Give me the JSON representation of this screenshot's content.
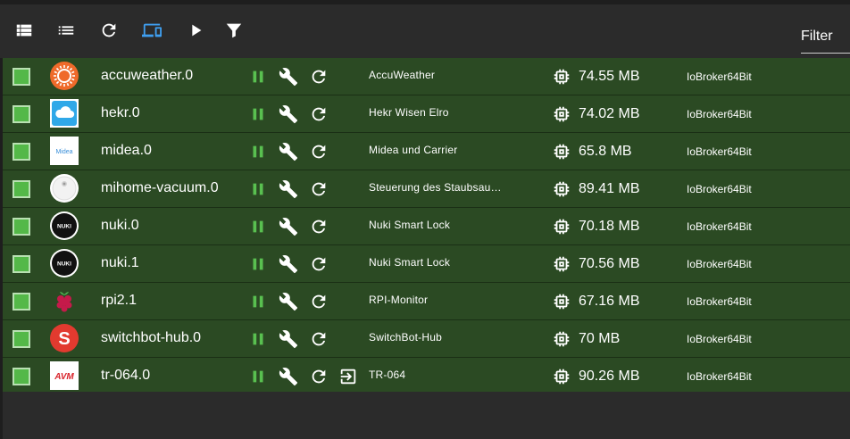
{
  "toolbar": {
    "buttons": [
      {
        "icon": "view-list-icon"
      },
      {
        "icon": "view-compact-list-icon"
      },
      {
        "icon": "refresh-icon"
      },
      {
        "icon": "devices-icon"
      },
      {
        "icon": "play-icon"
      },
      {
        "icon": "filter-icon"
      }
    ],
    "filter_placeholder": "Filter"
  },
  "colors": {
    "row_bg": "#2b4a23",
    "accent_blue": "#3f9ff0",
    "pause_green": "#59c050",
    "checkbox_green": "#54b848"
  },
  "instances": [
    {
      "name": "accuweather.0",
      "title": "AccuWeather",
      "memory": "74.55 MB",
      "host": "IoBroker64Bit",
      "logo": "accuweather-logo-icon",
      "has_link": false
    },
    {
      "name": "hekr.0",
      "title": "Hekr Wisen Elro",
      "memory": "74.02 MB",
      "host": "IoBroker64Bit",
      "logo": "hekr-cloud-logo-icon",
      "has_link": false
    },
    {
      "name": "midea.0",
      "title": "Midea und Carrier",
      "memory": "65.8 MB",
      "host": "IoBroker64Bit",
      "logo": "midea-logo-icon",
      "has_link": false
    },
    {
      "name": "mihome-vacuum.0",
      "title": "Steuerung des Staubsau…",
      "memory": "89.41 MB",
      "host": "IoBroker64Bit",
      "logo": "vacuum-robot-logo-icon",
      "has_link": false
    },
    {
      "name": "nuki.0",
      "title": "Nuki Smart Lock",
      "memory": "70.18 MB",
      "host": "IoBroker64Bit",
      "logo": "nuki-logo-icon",
      "has_link": false
    },
    {
      "name": "nuki.1",
      "title": "Nuki Smart Lock",
      "memory": "70.56 MB",
      "host": "IoBroker64Bit",
      "logo": "nuki-logo-icon",
      "has_link": false
    },
    {
      "name": "rpi2.1",
      "title": "RPI-Monitor",
      "memory": "67.16 MB",
      "host": "IoBroker64Bit",
      "logo": "raspberry-pi-logo-icon",
      "has_link": false
    },
    {
      "name": "switchbot-hub.0",
      "title": "SwitchBot-Hub",
      "memory": "70 MB",
      "host": "IoBroker64Bit",
      "logo": "switchbot-logo-icon",
      "has_link": false
    },
    {
      "name": "tr-064.0",
      "title": "TR-064",
      "memory": "90.26 MB",
      "host": "IoBroker64Bit",
      "logo": "avm-logo-icon",
      "has_link": true
    }
  ],
  "logo_text": {
    "midea": "Midea",
    "nuki": "NUKI",
    "switchbot": "S",
    "avm": "AVM"
  }
}
